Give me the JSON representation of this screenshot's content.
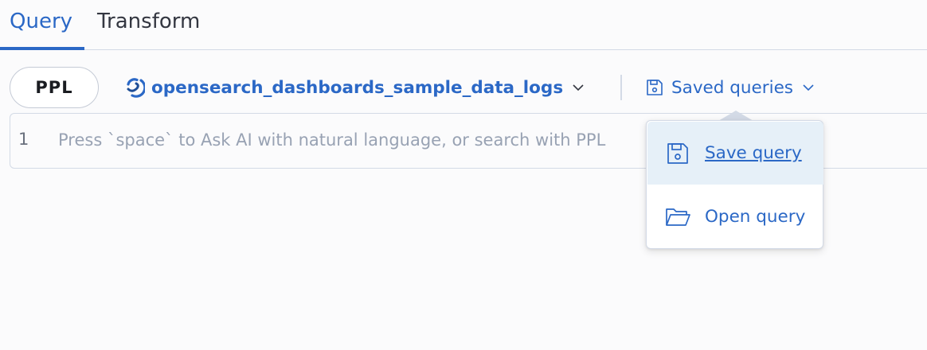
{
  "tabs": {
    "query": "Query",
    "transform": "Transform"
  },
  "toolbar": {
    "language": "PPL",
    "datasource": "opensearch_dashboards_sample_data_logs",
    "saved_queries": "Saved queries"
  },
  "editor": {
    "line_number": "1",
    "placeholder": "Press `space` to Ask AI with natural language, or search with PPL"
  },
  "saved_menu": {
    "items": [
      {
        "label": "Save query",
        "icon": "save-icon"
      },
      {
        "label": "Open query",
        "icon": "folder-open-icon"
      }
    ]
  },
  "colors": {
    "accent": "#2b68c6",
    "text": "#343741",
    "border": "#d3dae6",
    "highlight": "#e6f0f8"
  }
}
